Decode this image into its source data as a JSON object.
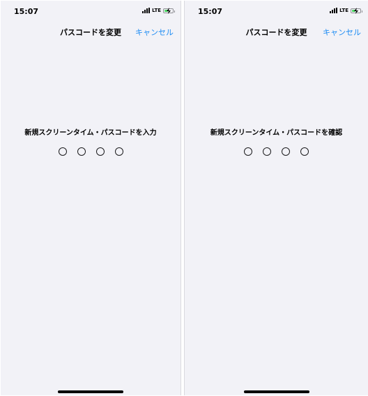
{
  "left": {
    "status": {
      "time": "15:07",
      "network": "LTE"
    },
    "nav": {
      "title": "パスコードを変更",
      "cancel_label": "キャンセル"
    },
    "prompt": "新規スクリーンタイム・パスコードを入力",
    "passcode_digits_entered": 0,
    "passcode_length": 4
  },
  "right": {
    "status": {
      "time": "15:07",
      "network": "LTE"
    },
    "nav": {
      "title": "パスコードを変更",
      "cancel_label": "キャンセル"
    },
    "prompt": "新規スクリーンタイム・パスコードを確認",
    "passcode_digits_entered": 0,
    "passcode_length": 4
  },
  "colors": {
    "accent": "#1b8bf4",
    "background": "#f2f2f7",
    "battery": "#4cd964"
  },
  "icons": [
    "cellular-signal-icon",
    "battery-charging-icon"
  ]
}
